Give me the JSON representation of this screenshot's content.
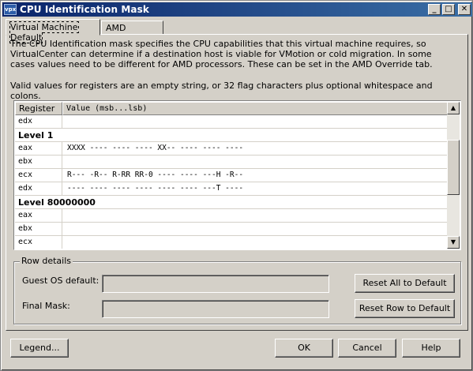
{
  "window": {
    "icon_text": "vpx",
    "title": "CPU Identification Mask",
    "minimize": "_",
    "maximize": "□",
    "close": "✕"
  },
  "tabs": [
    {
      "label": "Virtual Machine Default"
    },
    {
      "label": "AMD Override"
    }
  ],
  "description": "The CPU Identification mask specifies the CPU capabilities that this virtual machine requires, so VirtualCenter can determine if a destination host is viable for VMotion or cold migration. In some cases values need to be different for AMD processors. These can be set in the AMD Override tab.",
  "valid_values": "Valid values for registers are an empty string, or 32 flag characters plus optional whitespace and colons.",
  "grid": {
    "headers": {
      "register": "Register",
      "value": "Value (msb...lsb)"
    },
    "rows": [
      {
        "register": "edx",
        "value": ""
      },
      {
        "level": "Level 1"
      },
      {
        "register": "eax",
        "value": "XXXX ---- ---- ---- XX-- ---- ---- ----"
      },
      {
        "register": "ebx",
        "value": ""
      },
      {
        "register": "ecx",
        "value": "R--- -R-- R-RR RR-0 ---- ---- ---H -R--"
      },
      {
        "register": "edx",
        "value": "---- ---- ---- ---- ---- ---- ---T ----"
      },
      {
        "level": "Level 80000000"
      },
      {
        "register": "eax",
        "value": ""
      },
      {
        "register": "ebx",
        "value": ""
      },
      {
        "register": "ecx",
        "value": ""
      }
    ],
    "scroll_up": "▲",
    "scroll_down": "▼"
  },
  "row_details": {
    "group_label": "Row details",
    "guest_os_label": "Guest OS default:",
    "guest_os_value": "",
    "final_mask_label": "Final Mask:",
    "final_mask_value": "",
    "reset_all_label": "Reset All to Default",
    "reset_row_label": "Reset Row to Default"
  },
  "footer": {
    "legend_label": "Legend...",
    "ok_label": "OK",
    "cancel_label": "Cancel",
    "help_label": "Help"
  }
}
